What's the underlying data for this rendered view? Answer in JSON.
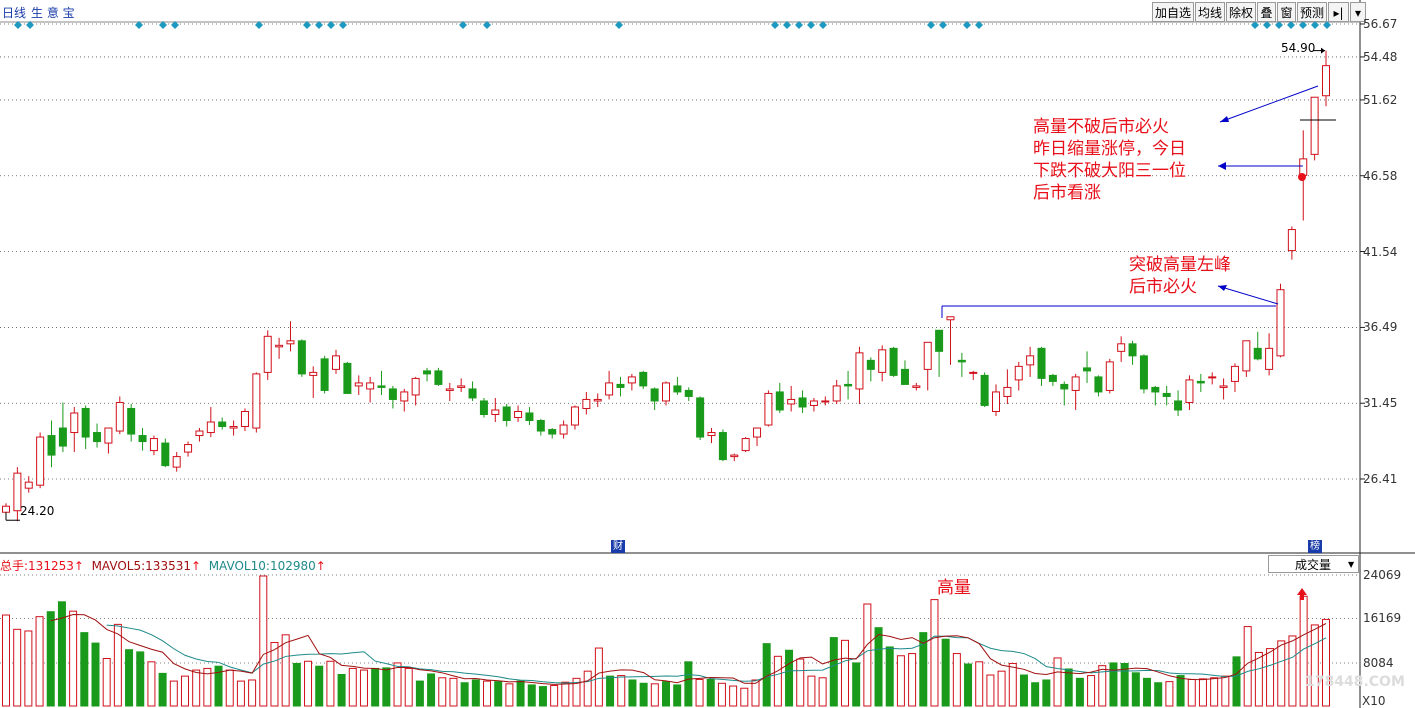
{
  "header": {
    "period": "日线",
    "product": "生 意 宝"
  },
  "toolbar": [
    {
      "label": "加自选"
    },
    {
      "label": "均线"
    },
    {
      "label": "除权"
    },
    {
      "label": "叠"
    },
    {
      "label": "窗"
    },
    {
      "label": "预测"
    },
    {
      "label": "▸|"
    },
    {
      "label": "▾"
    }
  ],
  "volume_header": {
    "total_label": "总手:",
    "total_value": "131253",
    "mavol5_label": "MAVOL5:",
    "mavol5_value": "133531",
    "mavol10_label": "MAVOL10:",
    "mavol10_value": "102980",
    "up_arrow": "↑",
    "dropdown_label": "成交量",
    "dropdown_arrow": "▼"
  },
  "markers": {
    "cai": "财",
    "bang": "榜",
    "x10": "X10",
    "watermark": "178448.COM"
  },
  "annotations": {
    "high_label": "54.90",
    "low_label": "24.20",
    "note1_lines": [
      "高量不破后市必火",
      "昨日缩量涨停，今日",
      "下跌不破大阳三一位",
      "后市看涨"
    ],
    "note2_lines": [
      "突破高量左峰",
      "后市必火"
    ],
    "vol_note": "高量"
  },
  "colors": {
    "up": "#d0101a",
    "down": "#1a9a1a",
    "accent_blue": "#0000c8",
    "marker": "#1e9ac0",
    "ma5": "#a01010",
    "ma10": "#1e8a8a"
  },
  "chart_data": [
    {
      "type": "candlestick",
      "y_ticks": [
        56.67,
        54.48,
        51.62,
        46.58,
        41.54,
        36.49,
        31.45,
        26.41
      ],
      "ylim": [
        22.0,
        58.0
      ],
      "candles": [
        [
          24.2,
          24.8,
          24.2,
          24.6
        ],
        [
          24.3,
          27.2,
          23.6,
          26.8
        ],
        [
          25.8,
          26.6,
          25.5,
          26.2
        ],
        [
          26.0,
          29.5,
          25.8,
          29.2
        ],
        [
          29.3,
          30.3,
          27.2,
          28.0
        ],
        [
          29.8,
          31.5,
          28.2,
          28.6
        ],
        [
          29.5,
          31.2,
          28.2,
          30.8
        ],
        [
          31.1,
          31.3,
          28.4,
          29.2
        ],
        [
          29.5,
          30.1,
          28.5,
          28.9
        ],
        [
          28.8,
          29.8,
          28.1,
          29.8
        ],
        [
          29.6,
          31.9,
          29.4,
          31.5
        ],
        [
          31.1,
          31.4,
          28.9,
          29.4
        ],
        [
          29.3,
          29.8,
          28.3,
          28.9
        ],
        [
          28.3,
          29.3,
          28.0,
          29.1
        ],
        [
          28.8,
          29.1,
          27.2,
          27.3
        ],
        [
          27.2,
          28.2,
          26.9,
          27.9
        ],
        [
          28.2,
          28.9,
          27.9,
          28.7
        ],
        [
          29.3,
          29.8,
          28.9,
          29.6
        ],
        [
          29.5,
          31.2,
          29.2,
          30.2
        ],
        [
          30.2,
          30.5,
          29.7,
          29.9
        ],
        [
          29.8,
          30.3,
          29.3,
          29.9
        ],
        [
          29.9,
          31.1,
          29.6,
          30.9
        ],
        [
          29.8,
          33.5,
          29.5,
          33.4
        ],
        [
          33.5,
          36.3,
          33.0,
          35.9
        ],
        [
          35.2,
          35.8,
          34.4,
          35.3
        ],
        [
          35.4,
          36.9,
          34.9,
          35.6
        ],
        [
          35.6,
          35.7,
          33.2,
          33.4
        ],
        [
          33.3,
          33.9,
          31.8,
          33.5
        ],
        [
          34.4,
          34.6,
          32.1,
          32.3
        ],
        [
          33.7,
          35.0,
          33.4,
          34.6
        ],
        [
          34.1,
          34.2,
          32.1,
          32.1
        ],
        [
          32.6,
          33.3,
          32.0,
          32.8
        ],
        [
          32.4,
          33.2,
          31.5,
          32.8
        ],
        [
          32.6,
          33.6,
          32.0,
          32.5
        ],
        [
          32.4,
          32.6,
          31.1,
          31.7
        ],
        [
          31.6,
          32.4,
          30.9,
          32.2
        ],
        [
          32.0,
          33.2,
          31.3,
          33.1
        ],
        [
          33.6,
          33.8,
          32.9,
          33.4
        ],
        [
          33.6,
          33.8,
          32.6,
          32.7
        ],
        [
          32.3,
          32.8,
          31.6,
          32.4
        ],
        [
          32.5,
          33.1,
          32.2,
          32.6
        ],
        [
          32.4,
          32.9,
          31.6,
          31.8
        ],
        [
          31.6,
          31.8,
          30.5,
          30.7
        ],
        [
          30.7,
          31.8,
          30.2,
          31.0
        ],
        [
          31.2,
          31.4,
          29.9,
          30.3
        ],
        [
          30.5,
          31.3,
          30.2,
          30.9
        ],
        [
          30.8,
          31.2,
          30.0,
          30.3
        ],
        [
          30.3,
          30.4,
          29.3,
          29.6
        ],
        [
          29.7,
          29.8,
          29.1,
          29.4
        ],
        [
          29.4,
          30.3,
          29.1,
          30.0
        ],
        [
          30.0,
          31.3,
          29.7,
          31.2
        ],
        [
          31.1,
          32.2,
          30.7,
          31.7
        ],
        [
          31.6,
          32.1,
          31.2,
          31.7
        ],
        [
          32.0,
          33.6,
          31.7,
          32.8
        ],
        [
          32.7,
          33.2,
          31.9,
          32.5
        ],
        [
          32.8,
          33.4,
          32.3,
          33.2
        ],
        [
          33.5,
          33.6,
          32.4,
          32.6
        ],
        [
          32.4,
          32.5,
          31.0,
          31.6
        ],
        [
          31.6,
          32.9,
          31.3,
          32.8
        ],
        [
          32.6,
          33.2,
          32.0,
          32.2
        ],
        [
          32.3,
          32.5,
          31.6,
          31.9
        ],
        [
          31.8,
          31.9,
          29.0,
          29.2
        ],
        [
          29.3,
          29.8,
          28.8,
          29.5
        ],
        [
          29.5,
          29.7,
          27.6,
          27.7
        ],
        [
          27.9,
          28.1,
          27.6,
          28.0
        ],
        [
          28.3,
          29.2,
          28.2,
          29.1
        ],
        [
          29.2,
          29.8,
          28.6,
          29.8
        ],
        [
          30.0,
          32.3,
          29.9,
          32.1
        ],
        [
          32.2,
          32.8,
          30.8,
          31.0
        ],
        [
          31.4,
          32.6,
          30.9,
          31.7
        ],
        [
          31.8,
          32.3,
          30.8,
          31.2
        ],
        [
          31.3,
          31.8,
          30.9,
          31.6
        ],
        [
          31.6,
          31.9,
          31.3,
          31.6
        ],
        [
          31.6,
          33.0,
          31.4,
          32.6
        ],
        [
          32.7,
          33.6,
          31.7,
          32.6
        ],
        [
          32.4,
          35.2,
          31.4,
          34.8
        ],
        [
          34.3,
          34.5,
          32.9,
          33.7
        ],
        [
          33.5,
          35.3,
          32.9,
          35.0
        ],
        [
          35.1,
          35.2,
          33.2,
          33.3
        ],
        [
          33.7,
          34.3,
          32.8,
          32.7
        ],
        [
          32.5,
          32.8,
          32.3,
          32.6
        ],
        [
          33.7,
          35.2,
          32.3,
          35.5
        ],
        [
          36.3,
          36.2,
          33.2,
          34.9
        ],
        [
          37.0,
          37.1,
          34.0,
          37.2
        ],
        [
          34.3,
          34.8,
          33.2,
          34.2
        ],
        [
          33.5,
          33.6,
          33.0,
          33.5
        ],
        [
          33.3,
          33.5,
          31.2,
          31.3
        ],
        [
          30.9,
          32.7,
          30.6,
          32.2
        ],
        [
          31.9,
          33.7,
          31.4,
          32.5
        ],
        [
          33.0,
          34.2,
          32.3,
          33.9
        ],
        [
          34.0,
          35.2,
          33.2,
          34.6
        ],
        [
          35.1,
          35.2,
          32.6,
          33.1
        ],
        [
          33.3,
          33.4,
          32.6,
          32.9
        ],
        [
          32.7,
          32.9,
          31.3,
          32.4
        ],
        [
          32.3,
          33.4,
          31.0,
          33.2
        ],
        [
          33.8,
          34.9,
          32.8,
          33.6
        ],
        [
          33.2,
          33.3,
          31.9,
          32.2
        ],
        [
          32.3,
          34.4,
          32.1,
          34.2
        ],
        [
          34.9,
          35.9,
          34.2,
          35.4
        ],
        [
          35.4,
          35.6,
          34.0,
          34.6
        ],
        [
          34.6,
          34.7,
          32.1,
          32.4
        ],
        [
          32.5,
          32.6,
          31.3,
          32.2
        ],
        [
          32.1,
          32.6,
          31.3,
          31.9
        ],
        [
          31.6,
          32.3,
          30.6,
          31.0
        ],
        [
          31.5,
          33.3,
          31.0,
          33.0
        ],
        [
          32.9,
          33.4,
          32.2,
          32.8
        ],
        [
          33.2,
          33.5,
          32.7,
          33.2
        ],
        [
          32.5,
          33.1,
          31.7,
          32.6
        ],
        [
          32.9,
          34.1,
          32.2,
          33.9
        ],
        [
          33.6,
          35.4,
          33.2,
          35.6
        ],
        [
          35.1,
          36.2,
          34.3,
          34.4
        ],
        [
          33.7,
          36.1,
          33.3,
          35.1
        ],
        [
          34.6,
          39.4,
          34.5,
          39.0
        ],
        [
          41.6,
          43.2,
          41.0,
          43.0
        ],
        [
          46.6,
          49.6,
          43.6,
          47.7
        ],
        [
          48.0,
          51.8,
          47.6,
          51.8
        ],
        [
          51.9,
          54.9,
          51.2,
          53.9
        ]
      ],
      "volume": {
        "y_ticks": [
          24069,
          16169,
          8084
        ],
        "ylim": [
          0,
          25500
        ],
        "values": [
          16800,
          14200,
          13900,
          16500,
          17400,
          19200,
          17500,
          13600,
          11700,
          8900,
          15100,
          10500,
          10100,
          8300,
          6200,
          4800,
          5700,
          6800,
          7100,
          7500,
          6800,
          4800,
          5000,
          24069,
          11800,
          13200,
          8000,
          8400,
          7500,
          8400,
          6000,
          7100,
          6800,
          7100,
          7200,
          8100,
          7100,
          4800,
          6100,
          5400,
          5300,
          4500,
          5000,
          4800,
          4700,
          4300,
          4800,
          4100,
          3800,
          4000,
          4600,
          5300,
          6600,
          10800,
          5700,
          5800,
          5000,
          4400,
          4300,
          4700,
          4100,
          8300,
          5100,
          5100,
          4400,
          3900,
          3500,
          5000,
          11600,
          9300,
          10400,
          8800,
          5700,
          5400,
          12700,
          12200,
          8100,
          18800,
          14500,
          11000,
          9400,
          9800,
          13600,
          19600,
          12400,
          9800,
          7900,
          8300,
          5900,
          6600,
          8000,
          5900,
          4500,
          5000,
          9000,
          7000,
          5300,
          5800,
          7600,
          8100,
          8000,
          6300,
          5300,
          4500,
          4700,
          5800,
          5100,
          5200,
          5400,
          5700,
          9200,
          14700,
          10000,
          10700,
          12100,
          13000,
          20200,
          15000,
          16000
        ]
      },
      "mavol5": {
        "last": 133531
      },
      "mavol10": {
        "last": 102980
      },
      "extremes": {
        "high": 54.9,
        "low": 24.2
      }
    }
  ]
}
